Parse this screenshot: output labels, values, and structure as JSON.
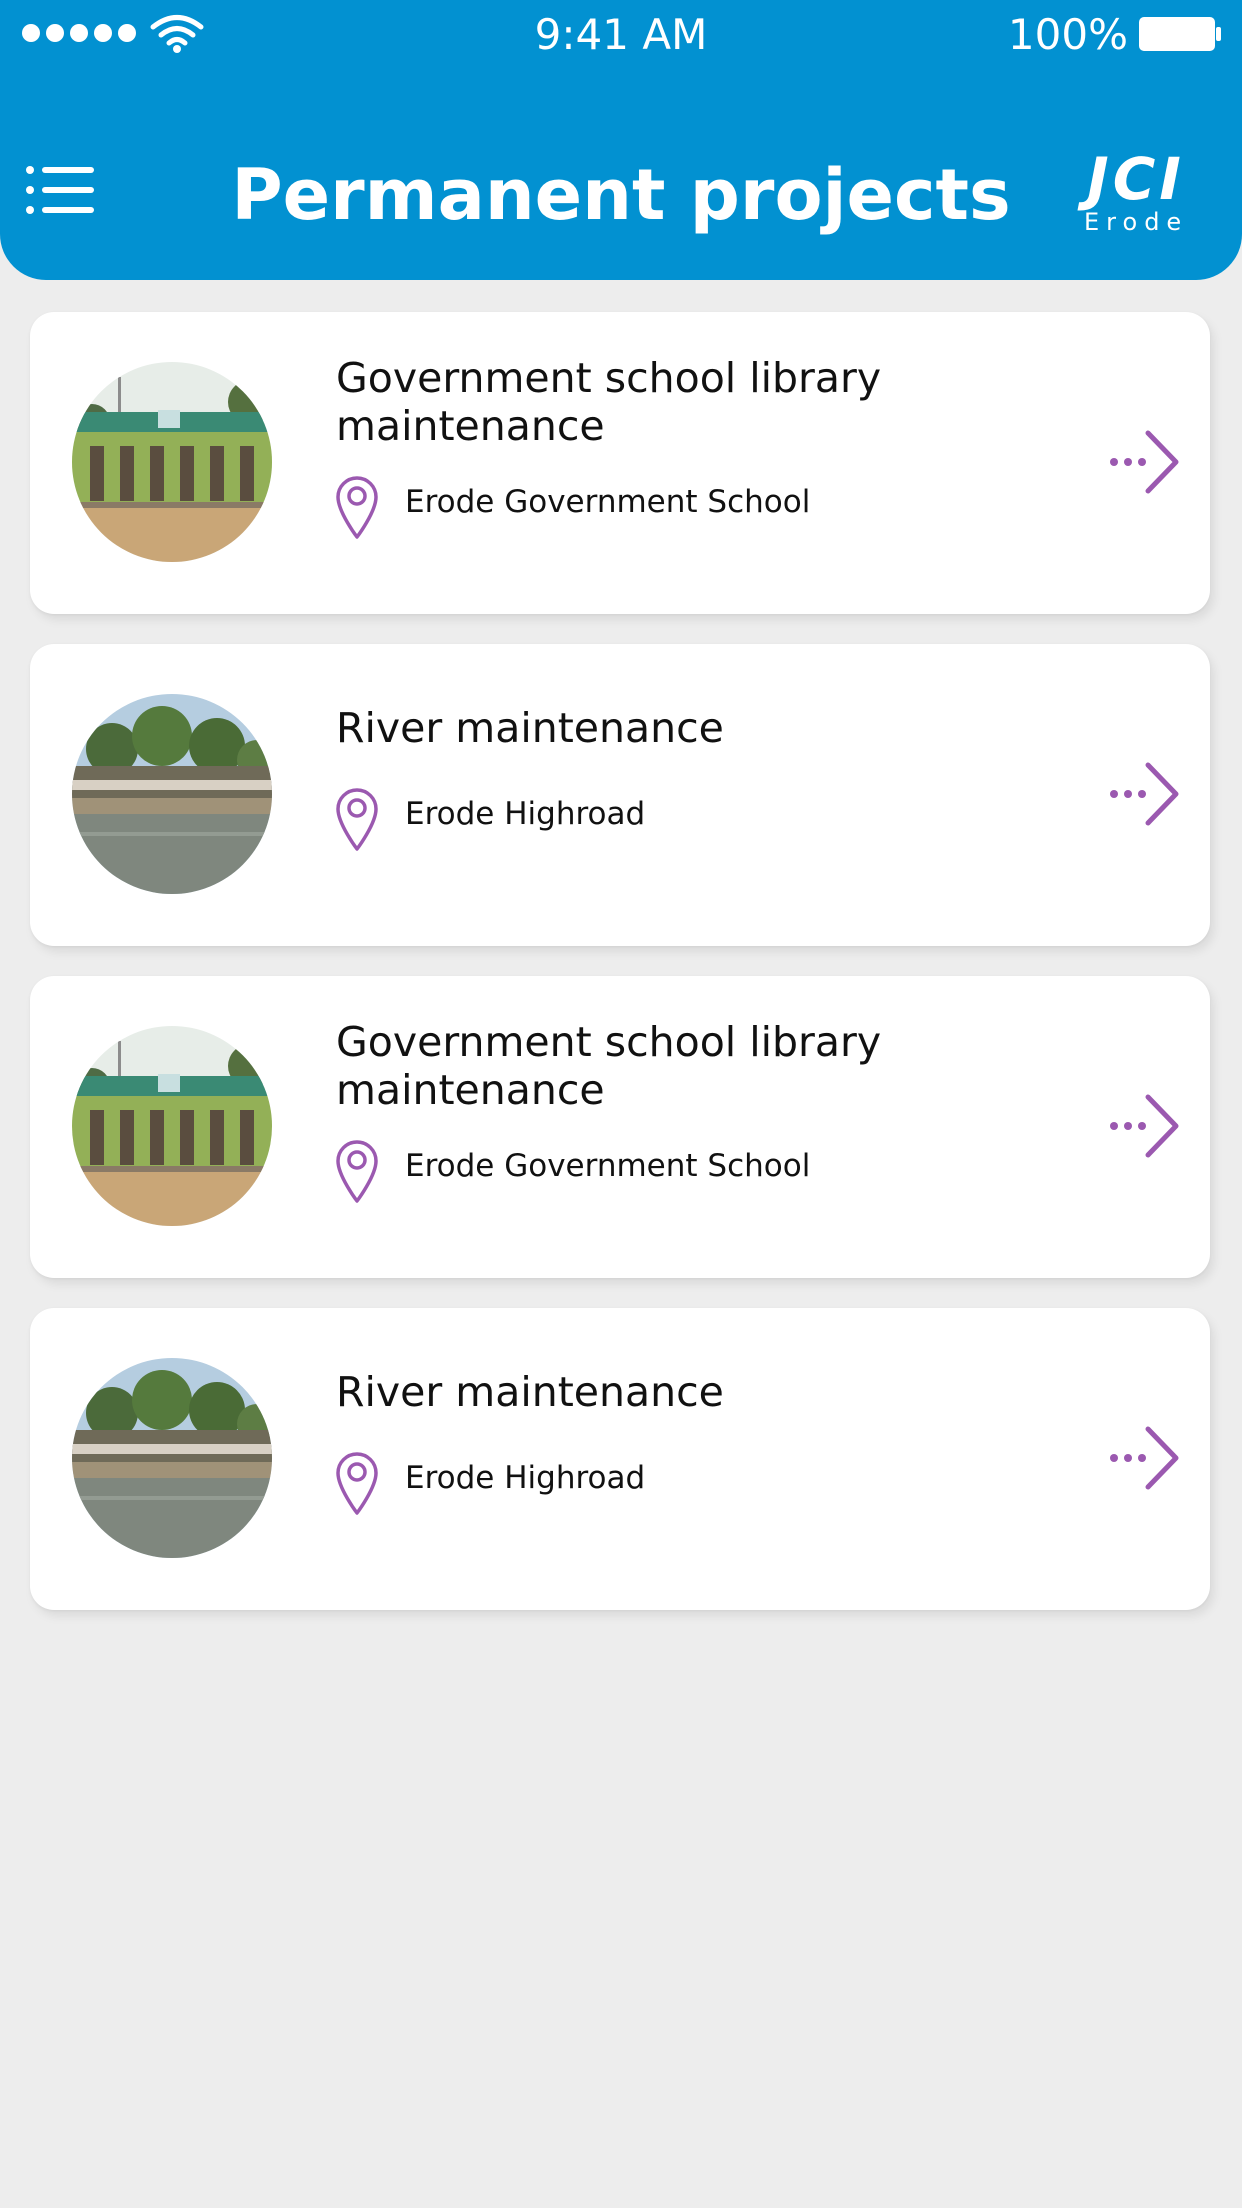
{
  "status_bar": {
    "time": "9:41 AM",
    "battery_percent": "100%"
  },
  "header": {
    "title": "Permanent projects",
    "brand_main": "JCI",
    "brand_sub": "Erode"
  },
  "projects": [
    {
      "title": "Government school library maintenance",
      "location": "Erode Government School",
      "thumbnail": "school-photo"
    },
    {
      "title": "River maintenance",
      "location": "Erode Highroad",
      "thumbnail": "river-photo"
    },
    {
      "title": "Government school library maintenance",
      "location": "Erode Government School",
      "thumbnail": "school-photo"
    },
    {
      "title": "River maintenance",
      "location": "Erode Highroad",
      "thumbnail": "river-photo"
    }
  ],
  "colors": {
    "header_bg": "#0291d1",
    "accent_purple": "#9b59b0",
    "page_bg": "#ededed"
  }
}
